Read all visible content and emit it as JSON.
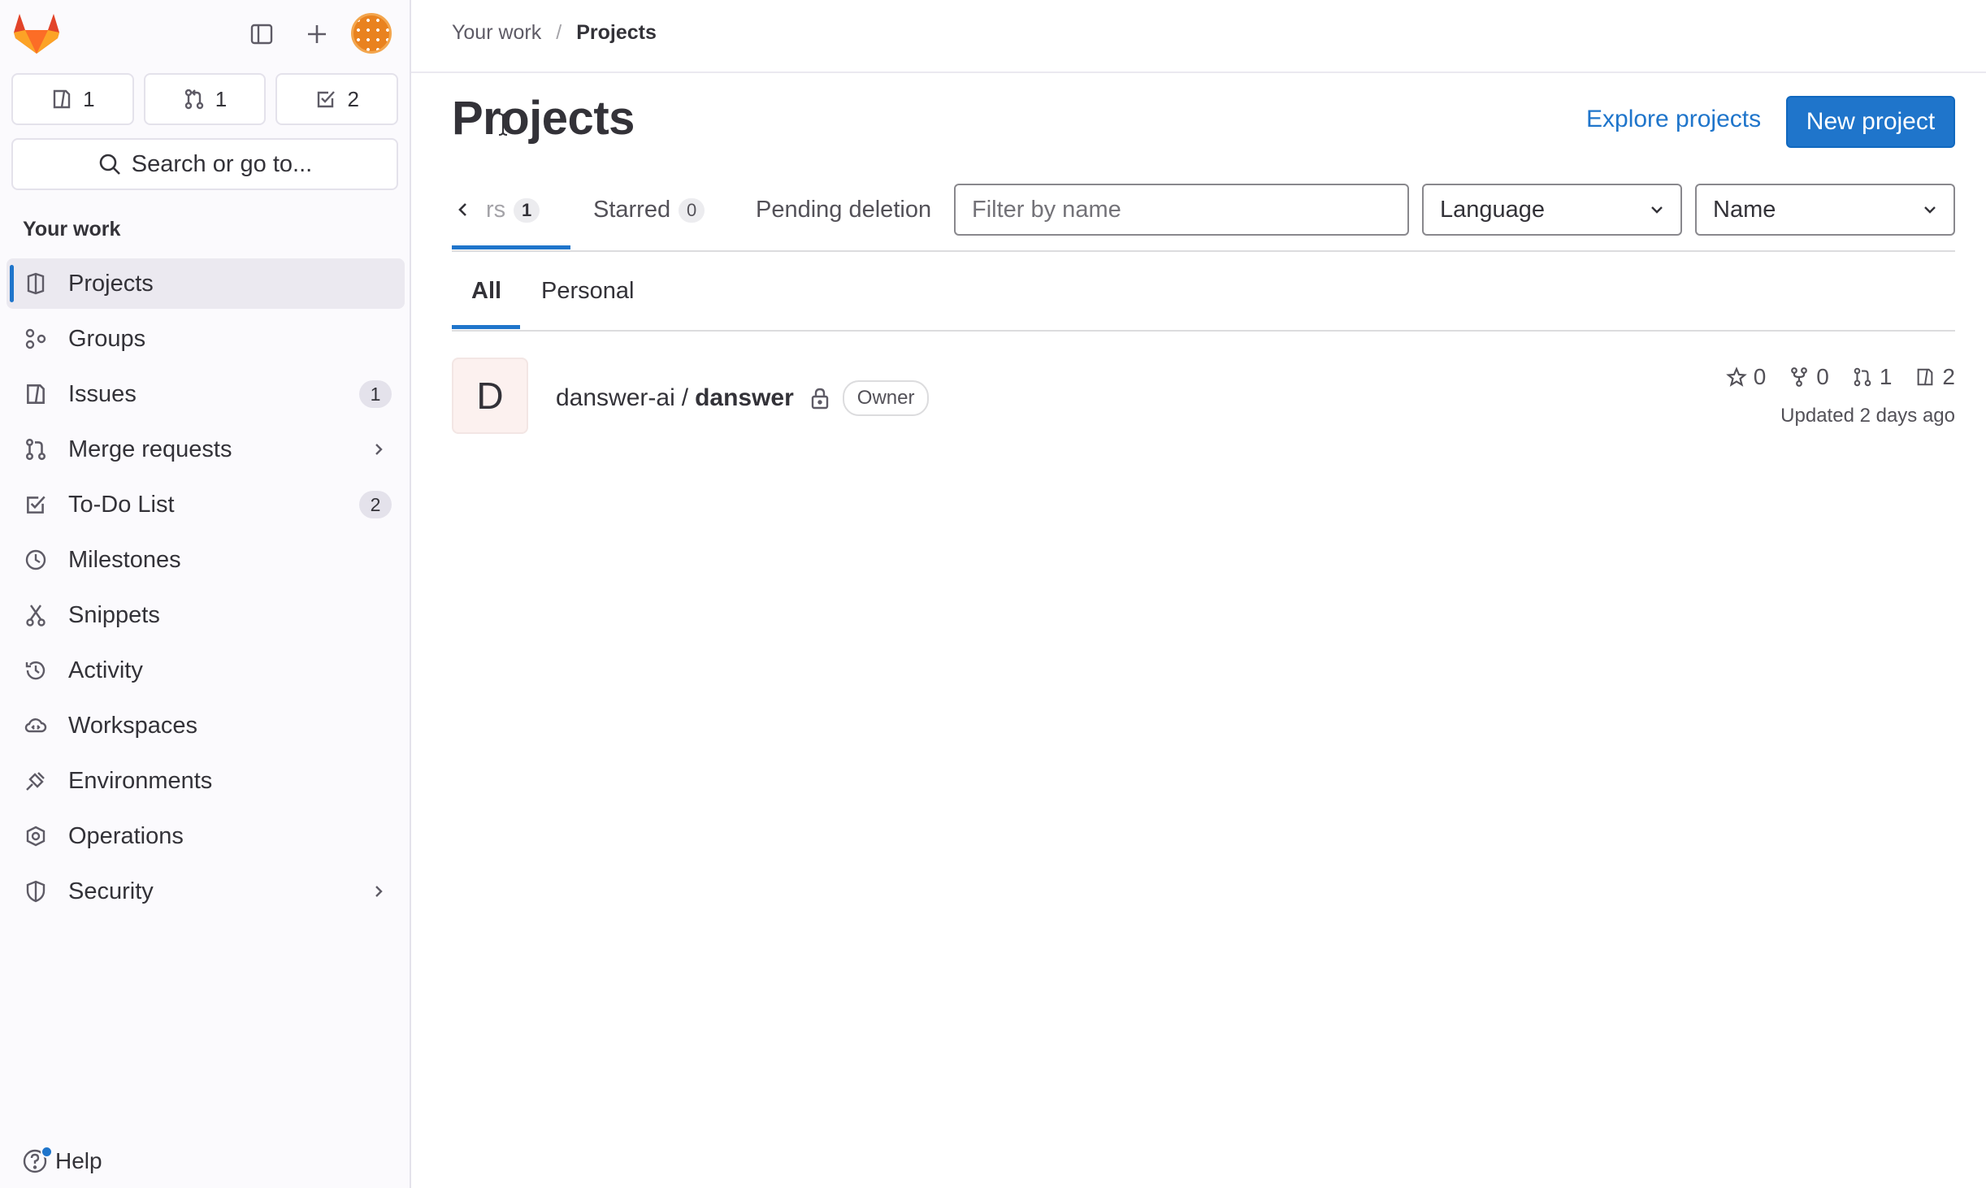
{
  "sidebar": {
    "counters": [
      {
        "icon": "issues-icon",
        "count": "1"
      },
      {
        "icon": "merge-request-icon",
        "count": "1"
      },
      {
        "icon": "todo-icon",
        "count": "2"
      }
    ],
    "search_label": "Search or go to...",
    "section_label": "Your work",
    "items": [
      {
        "label": "Projects",
        "icon": "project-icon",
        "active": true
      },
      {
        "label": "Groups",
        "icon": "group-icon"
      },
      {
        "label": "Issues",
        "icon": "issues-icon",
        "badge": "1"
      },
      {
        "label": "Merge requests",
        "icon": "merge-request-icon",
        "expandable": true
      },
      {
        "label": "To-Do List",
        "icon": "todo-icon",
        "badge": "2"
      },
      {
        "label": "Milestones",
        "icon": "clock-icon"
      },
      {
        "label": "Snippets",
        "icon": "snippet-icon"
      },
      {
        "label": "Activity",
        "icon": "history-icon"
      },
      {
        "label": "Workspaces",
        "icon": "cloud-icon"
      },
      {
        "label": "Environments",
        "icon": "environment-icon"
      },
      {
        "label": "Operations",
        "icon": "deployments-icon"
      },
      {
        "label": "Security",
        "icon": "shield-icon",
        "expandable": true
      }
    ],
    "help_label": "Help"
  },
  "breadcrumb": {
    "parent": "Your work",
    "separator": "/",
    "current": "Projects"
  },
  "header": {
    "title": "Projects",
    "explore_label": "Explore projects",
    "new_project_label": "New project"
  },
  "tabs": {
    "first_label_partial": "rs",
    "first_count": "1",
    "starred_label": "Starred",
    "starred_count": "0",
    "pending_label": "Pending deletion"
  },
  "filters": {
    "filter_placeholder": "Filter by name",
    "language_label": "Language",
    "sort_label": "Name"
  },
  "subtabs": {
    "all_label": "All",
    "personal_label": "Personal"
  },
  "project": {
    "avatar_letter": "D",
    "namespace": "danswer-ai",
    "separator": "/",
    "name": "danswer",
    "role": "Owner",
    "stars": "0",
    "forks": "0",
    "merge_requests": "1",
    "issues": "2",
    "updated": "Updated 2 days ago"
  },
  "colors": {
    "accent": "#1f75cb",
    "sidebar_bg": "#fbfafd",
    "active_item_bg": "#ebe9f0",
    "logo_orange": "#fc6d26"
  }
}
